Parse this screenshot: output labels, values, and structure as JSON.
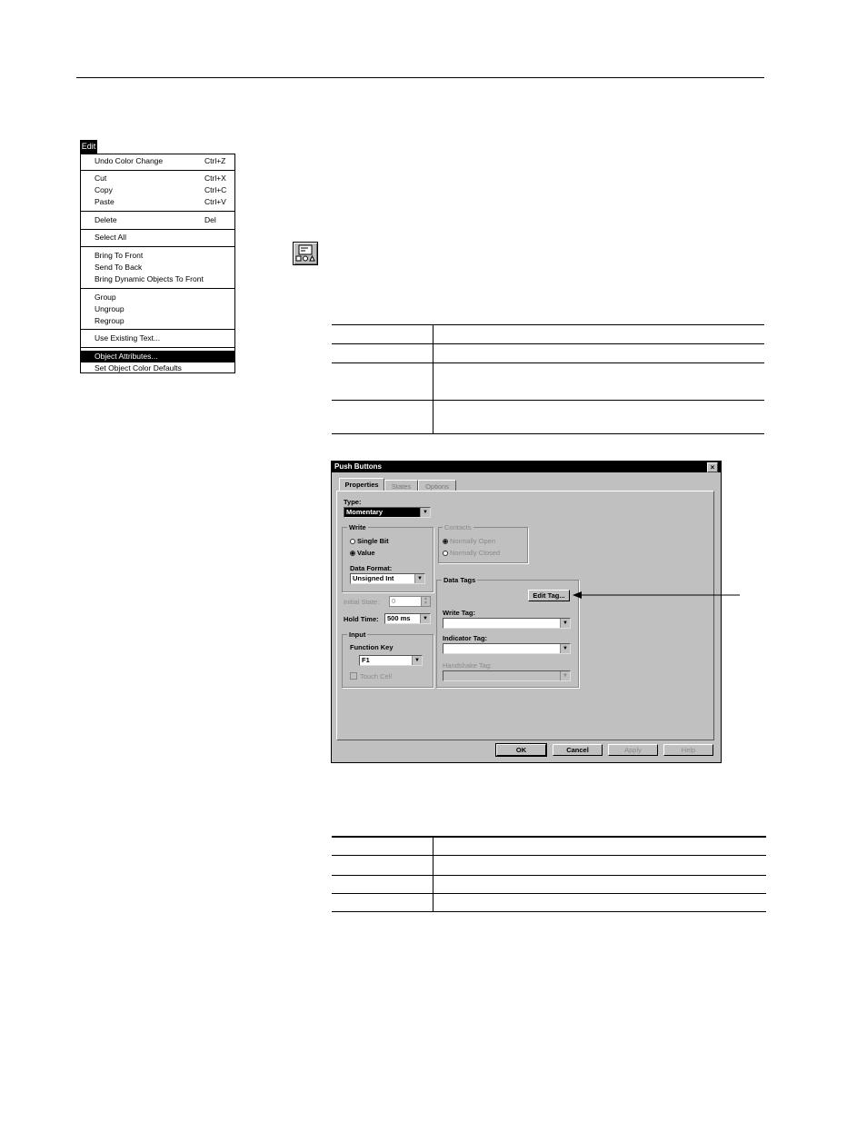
{
  "edit_menu": {
    "title": "Edit",
    "items": [
      {
        "label": "Undo Color Change",
        "shortcut": "Ctrl+Z"
      },
      {
        "label": "Cut",
        "shortcut": "Ctrl+X"
      },
      {
        "label": "Copy",
        "shortcut": "Ctrl+C"
      },
      {
        "label": "Paste",
        "shortcut": "Ctrl+V"
      },
      {
        "label": "Delete",
        "shortcut": "Del"
      },
      {
        "label": "Select All",
        "shortcut": ""
      },
      {
        "label": "Bring To Front",
        "shortcut": ""
      },
      {
        "label": "Send To Back",
        "shortcut": ""
      },
      {
        "label": "Bring Dynamic Objects To Front",
        "shortcut": ""
      },
      {
        "label": "Group",
        "shortcut": ""
      },
      {
        "label": "Ungroup",
        "shortcut": ""
      },
      {
        "label": "Regroup",
        "shortcut": ""
      },
      {
        "label": "Use Existing Text...",
        "shortcut": ""
      },
      {
        "label": "Object Attributes...",
        "shortcut": "",
        "highlighted": true
      },
      {
        "label": "Set Object Color Defaults",
        "shortcut": ""
      }
    ]
  },
  "toolbar_icon": {
    "icon": "push-button-tool-icon"
  },
  "dialog": {
    "title": "Push Buttons",
    "close": "×",
    "tabs": [
      "Properties",
      "States",
      "Options"
    ],
    "type_label": "Type:",
    "type_value": "Momentary",
    "write_group": "Write",
    "write_options": [
      "Single Bit",
      "Value"
    ],
    "contacts_group": "Contacts",
    "contacts_options": [
      "Normally Open",
      "Normally Closed"
    ],
    "data_format_label": "Data Format:",
    "data_format_value": "Unsigned Int",
    "data_tags_group": "Data Tags",
    "edit_tag_button": "Edit Tag...",
    "initial_state_label": "Initial State:",
    "initial_state_value": "0",
    "hold_time_label": "Hold Time:",
    "hold_time_value": "500 ms",
    "input_group": "Input",
    "function_key_label": "Function Key",
    "function_key_value": "F1",
    "touch_cell_label": "Touch Cell",
    "write_tag_label": "Write Tag:",
    "indicator_tag_label": "Indicator Tag:",
    "handshake_tag_label": "Handshake Tag:",
    "buttons": [
      "OK",
      "Cancel",
      "Apply",
      "Help"
    ]
  }
}
